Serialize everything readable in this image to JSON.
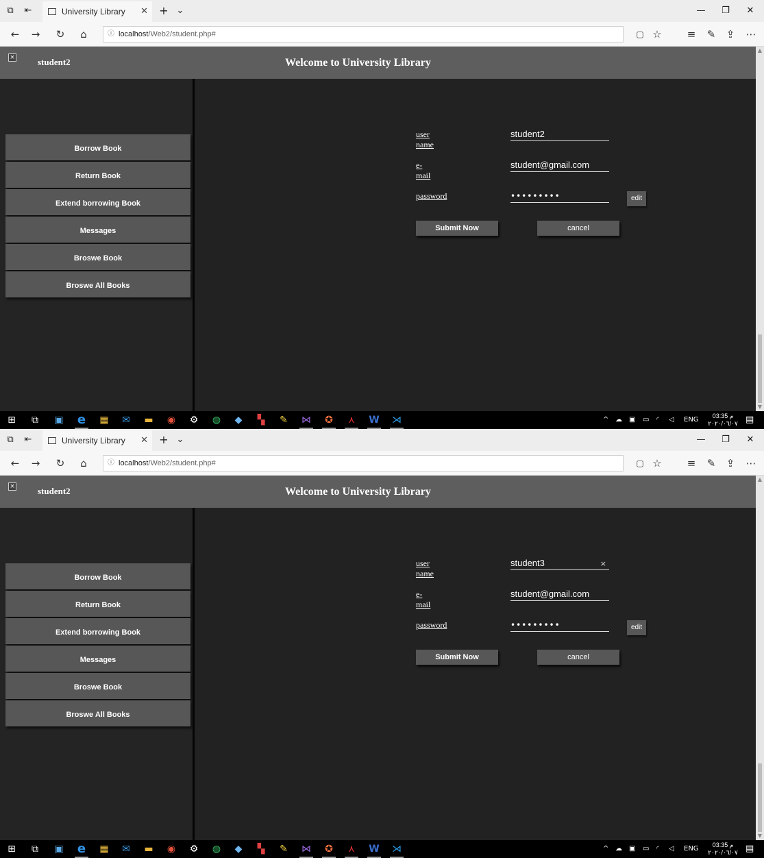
{
  "screens": [
    {
      "browser": {
        "tab_title": "University Library",
        "url_host": "localhost",
        "url_path": "/Web2/student.php#"
      },
      "header": {
        "username": "student2",
        "welcome": "Welcome to University Library"
      },
      "menu": [
        "Borrow Book",
        "Return Book",
        "Extend borrowing Book",
        "Messages",
        "Broswe Book",
        "Broswe All Books"
      ],
      "form": {
        "username_label": "user name",
        "username_value": "student2",
        "username_focused": false,
        "email_label": "e-mail",
        "email_value": "student@gmail.com",
        "password_label": "password",
        "password_value": "•••••••••",
        "edit_label": "edit",
        "submit_label": "Submit Now",
        "cancel_label": "cancel"
      },
      "taskbar": {
        "time": "03:35 م",
        "date": "٢٠٢٠/٠٦/٠٧",
        "lang": "ENG"
      }
    },
    {
      "browser": {
        "tab_title": "University Library",
        "url_host": "localhost",
        "url_path": "/Web2/student.php#"
      },
      "header": {
        "username": "student2",
        "welcome": "Welcome to University Library"
      },
      "menu": [
        "Borrow Book",
        "Return Book",
        "Extend borrowing Book",
        "Messages",
        "Broswe Book",
        "Broswe All Books"
      ],
      "form": {
        "username_label": "user name",
        "username_value": "student3",
        "username_focused": true,
        "email_label": "e-mail",
        "email_value": "student@gmail.com",
        "password_label": "password",
        "password_value": "•••••••••",
        "edit_label": "edit",
        "submit_label": "Submit Now",
        "cancel_label": "cancel"
      },
      "taskbar": {
        "time": "03:35 م",
        "date": "٢٠٢٠/٠٦/٠٧",
        "lang": "ENG"
      }
    }
  ]
}
